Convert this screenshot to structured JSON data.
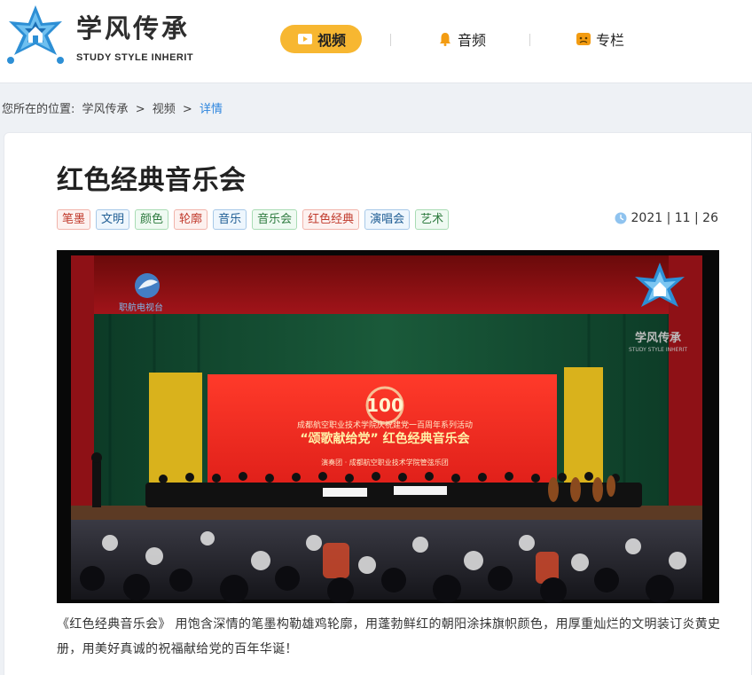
{
  "logo": {
    "cn": "学风传承",
    "en": "STUDY STYLE INHERIT"
  },
  "nav": [
    {
      "label": "视频",
      "icon": "play-icon",
      "active": true
    },
    {
      "label": "音频",
      "icon": "bell-icon",
      "active": false
    },
    {
      "label": "专栏",
      "icon": "column-icon",
      "active": false
    }
  ],
  "breadcrumb": {
    "prefix": "您所在的位置:",
    "home": "学风传承",
    "sep1": ">",
    "section": "视频",
    "sep2": ">",
    "current": "详情"
  },
  "article": {
    "title": "红色经典音乐会",
    "tags": [
      {
        "label": "笔墨",
        "color": "red"
      },
      {
        "label": "文明",
        "color": "blue"
      },
      {
        "label": "颜色",
        "color": "green"
      },
      {
        "label": "轮廓",
        "color": "red"
      },
      {
        "label": "音乐",
        "color": "blue"
      },
      {
        "label": "音乐会",
        "color": "green"
      },
      {
        "label": "红色经典",
        "color": "red"
      },
      {
        "label": "演唱会",
        "color": "blue"
      },
      {
        "label": "艺术",
        "color": "green"
      }
    ],
    "date": "2021 | 11 | 26",
    "caption": "《红色经典音乐会》 用饱含深情的笔墨构勒雄鸡轮廓，用蓬勃鲜红的朝阳涂抹旗帜颜色，用厚重灿烂的文明装订炎黄史册，用美好真诚的祝福献给党的百年华诞！"
  },
  "video": {
    "watermark_left": "职航电视台",
    "watermark_right_cn": "学风传承",
    "watermark_right_en": "STUDY STYLE INHERIT",
    "screen_line1": "成都航空职业技术学院庆祝建党一百周年系列活动",
    "screen_line2": "“颂歌献给党” 红色经典音乐会",
    "screen_line3": "演奏团 · 成都航空职业技术学院管弦乐团",
    "screen_number": "100"
  },
  "colors": {
    "accent": "#f7b731",
    "link": "#2e86de",
    "logo_blue": "#2d8fd5"
  }
}
